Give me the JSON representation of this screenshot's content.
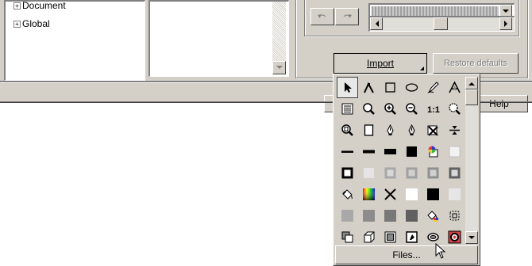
{
  "tree": {
    "items": [
      {
        "label": "Document"
      },
      {
        "label": "Global"
      }
    ]
  },
  "buttons": {
    "import": "Import",
    "restore": "Restore defaults",
    "help": "Help",
    "files": "Files..."
  },
  "icons": {
    "rows": [
      [
        "arrow-cursor",
        "node-edit-tool",
        "rectangle-tool",
        "ellipse-tool",
        "freehand-pen-tool",
        "text-tool"
      ],
      [
        "document-lines",
        "zoom-tool",
        "zoom-in",
        "zoom-out",
        "zoom-1-to-1",
        "zoom-to-fit"
      ],
      [
        "zoom-page",
        "blank-page",
        "pen-nib",
        "pen-nib-alt",
        "no-fill-cross",
        "distribute-vertical"
      ],
      [
        "line-thin",
        "line-medium",
        "line-thick",
        "black-square",
        "color-wheel",
        "light-square"
      ],
      [
        "outline-square",
        "gray-square-light",
        "gray-square",
        "gray-square-2",
        "gray-square-3",
        "gray-square-outline"
      ],
      [
        "paint-bucket",
        "color-gradient",
        "cross-x",
        "white-square",
        "black-square-2",
        "light-gray-square"
      ],
      [
        "gray-swatch-1",
        "gray-swatch-2",
        "gray-swatch-3",
        "gray-swatch-4",
        "paint-bucket-color",
        "object-frame"
      ],
      [
        "to-front",
        "cube-3d",
        "frame-square",
        "page-edit",
        "lens-ring",
        "red-circle"
      ]
    ]
  }
}
